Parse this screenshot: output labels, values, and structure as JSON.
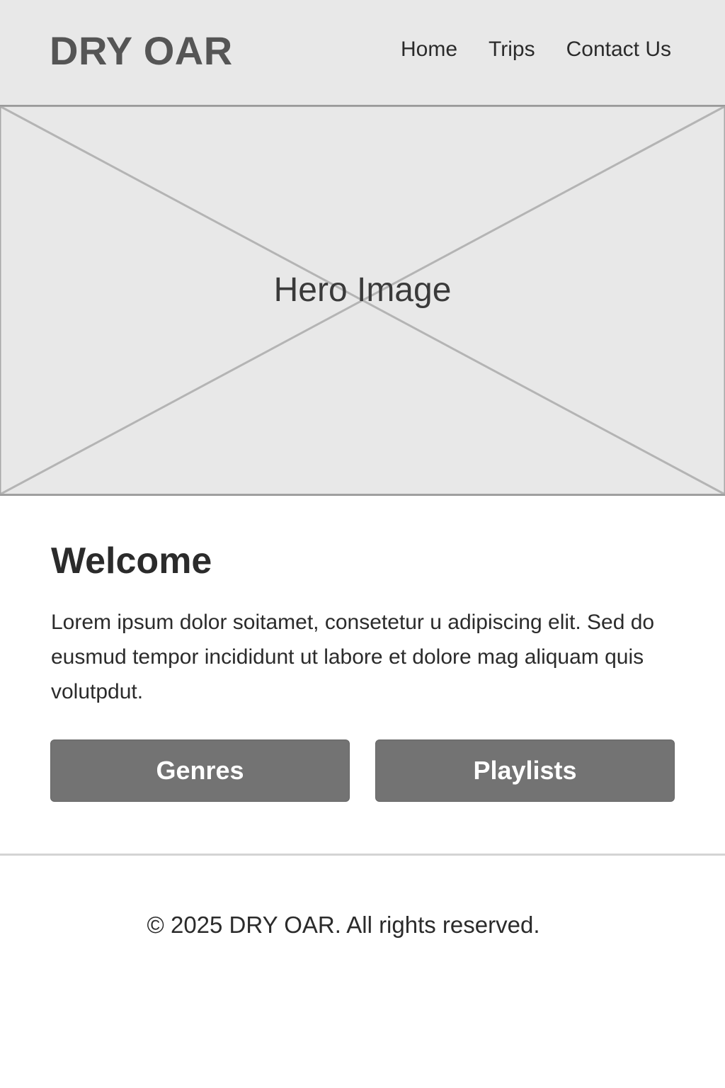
{
  "header": {
    "logo": "DRY OAR",
    "nav": [
      {
        "label": "Home"
      },
      {
        "label": "Trips"
      },
      {
        "label": "Contact Us"
      }
    ]
  },
  "hero": {
    "label": "Hero Image"
  },
  "main": {
    "heading": "Welcome",
    "paragraph": "Lorem ipsum dolor soitamet, consetetur u adipiscing elit. Sed do eusmud tempor incididunt ut labore et dolore mag aliquam quis volutpdut.",
    "buttons": [
      {
        "label": "Genres"
      },
      {
        "label": "Playlists"
      }
    ]
  },
  "footer": {
    "text": "© 2025 DRY OAR. All rights reserved."
  },
  "colors": {
    "header_bg": "#e8e8e8",
    "button_bg": "#737373",
    "divider": "#d4d4d4"
  }
}
